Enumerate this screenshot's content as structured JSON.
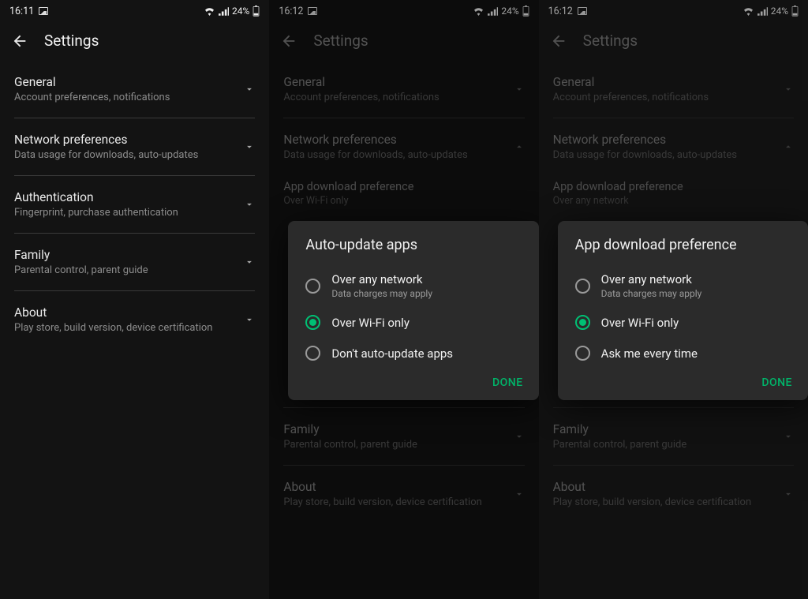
{
  "status": {
    "t1": "16:11",
    "t2": "16:12",
    "t3": "16:12",
    "batt": "24%"
  },
  "title": "Settings",
  "rows": {
    "general": {
      "t": "General",
      "s": "Account preferences, notifications"
    },
    "network": {
      "t": "Network preferences",
      "s": "Data usage for downloads, auto-updates"
    },
    "auth": {
      "t": "Authentication",
      "s": "Fingerprint, purchase authentication"
    },
    "family": {
      "t": "Family",
      "s": "Parental control, parent guide"
    },
    "about": {
      "t": "About",
      "s": "Play store, build version, device certification"
    },
    "appdl": {
      "t": "App download preference",
      "s1": "Over Wi-Fi only",
      "s2": "Over any network"
    }
  },
  "dialog1": {
    "title": "Auto-update apps",
    "opt1": {
      "l": "Over any network",
      "s": "Data charges may apply"
    },
    "opt2": {
      "l": "Over Wi-Fi only"
    },
    "opt3": {
      "l": "Don't auto-update apps"
    },
    "done": "DONE"
  },
  "dialog2": {
    "title": "App download preference",
    "opt1": {
      "l": "Over any network",
      "s": "Data charges may apply"
    },
    "opt2": {
      "l": "Over Wi-Fi only"
    },
    "opt3": {
      "l": "Ask me every time"
    },
    "done": "DONE"
  }
}
